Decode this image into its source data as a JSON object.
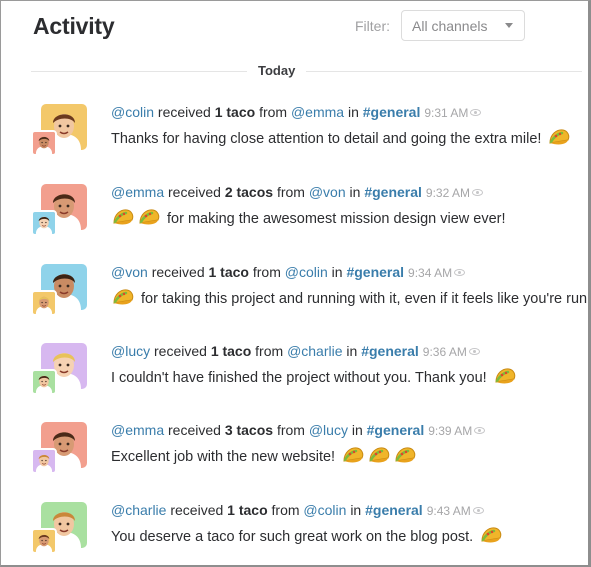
{
  "header": {
    "title": "Activity",
    "filter_label": "Filter:",
    "filter_value": "All channels"
  },
  "day_label": "Today",
  "items": [
    {
      "recipient": "@colin",
      "received": "received",
      "count": "1 taco",
      "from_word": "from",
      "sender": "@emma",
      "in_word": "in",
      "channel": "#general",
      "time": "9:31 AM",
      "message": "Thanks for having close attention to detail and going the extra mile!",
      "tacos_before": 0,
      "tacos_after": 1,
      "big_avatar_bg": "#f3c86a",
      "small_avatar_bg": "#f29f8e"
    },
    {
      "recipient": "@emma",
      "received": "received",
      "count": "2 tacos",
      "from_word": "from",
      "sender": "@von",
      "in_word": "in",
      "channel": "#general",
      "time": "9:32 AM",
      "message": "for making the awesomest mission design view ever!",
      "tacos_before": 2,
      "tacos_after": 0,
      "big_avatar_bg": "#f29f8e",
      "small_avatar_bg": "#8fd3ea"
    },
    {
      "recipient": "@von",
      "received": "received",
      "count": "1 taco",
      "from_word": "from",
      "sender": "@colin",
      "in_word": "in",
      "channel": "#general",
      "time": "9:34 AM",
      "message": "for taking this project and running with it, even if it feels like you're running",
      "tacos_before": 1,
      "tacos_after": 0,
      "big_avatar_bg": "#8fd3ea",
      "small_avatar_bg": "#f3c86a"
    },
    {
      "recipient": "@lucy",
      "received": "received",
      "count": "1 taco",
      "from_word": "from",
      "sender": "@charlie",
      "in_word": "in",
      "channel": "#general",
      "time": "9:36 AM",
      "message": "I couldn't have finished the project without you. Thank you!",
      "tacos_before": 0,
      "tacos_after": 1,
      "big_avatar_bg": "#d7b8f0",
      "small_avatar_bg": "#a9e0a0"
    },
    {
      "recipient": "@emma",
      "received": "received",
      "count": "3 tacos",
      "from_word": "from",
      "sender": "@lucy",
      "in_word": "in",
      "channel": "#general",
      "time": "9:39 AM",
      "message": "Excellent job with the new website!",
      "tacos_before": 0,
      "tacos_after": 3,
      "big_avatar_bg": "#f29f8e",
      "small_avatar_bg": "#d7b8f0"
    },
    {
      "recipient": "@charlie",
      "received": "received",
      "count": "1 taco",
      "from_word": "from",
      "sender": "@colin",
      "in_word": "in",
      "channel": "#general",
      "time": "9:43 AM",
      "message": "You deserve a taco for such great work on the blog post.",
      "tacos_before": 0,
      "tacos_after": 1,
      "big_avatar_bg": "#a9e0a0",
      "small_avatar_bg": "#f3c86a"
    }
  ],
  "colors": {
    "link": "#3a7dab",
    "taco_shell": "#f0b52a",
    "taco_fill": "#7dbb3c"
  }
}
